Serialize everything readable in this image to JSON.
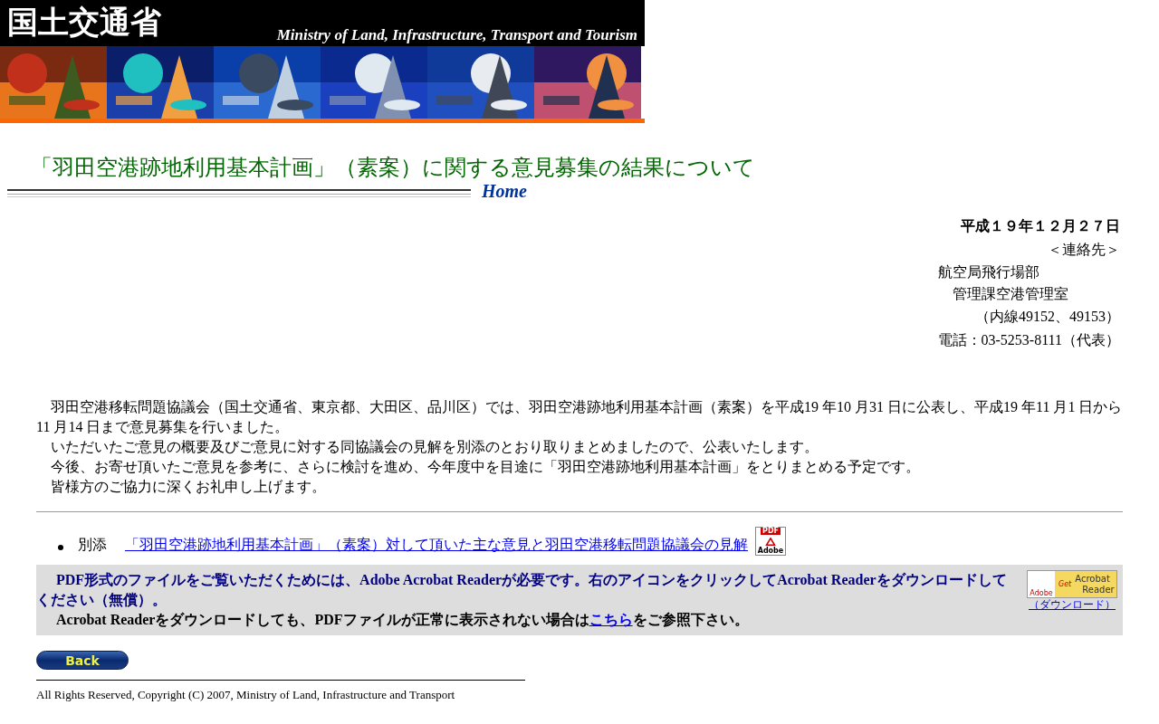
{
  "banner": {
    "title_ja": "国土交通省",
    "title_en": "Ministry of Land, Infrastructure, Transport and Tourism"
  },
  "page_title": "「羽田空港跡地利用基本計画」（素案）に関する意見募集の結果について",
  "home_link": "Home",
  "date": "平成１９年１２月２７日",
  "contact": {
    "heading": "＜連絡先＞",
    "lines": [
      "航空局飛行場部",
      "管理課空港管理室",
      "（内線49152、49153）",
      "電話：03-5253-8111（代表）"
    ]
  },
  "paragraphs": [
    "羽田空港移転問題協議会（国土交通省、東京都、大田区、品川区）では、羽田空港跡地利用基本計画（素案）を平成19 年10 月31 日に公表し、平成19 年11 月1 日から11 月14 日まで意見募集を行いました。",
    "いただいたご意見の概要及びご意見に対する同協議会の見解を別添のとおり取りまとめましたので、公表いたします。",
    "今後、お寄せ頂いたご意見を参考に、さらに検討を進め、今年度中を目途に「羽田空港跡地利用基本計画」をとりまとめる予定です。",
    "皆様方のご協力に深くお礼申し上げます。"
  ],
  "attachments": [
    {
      "label": "別添",
      "link": "「羽田空港跡地利用基本計画」（素案）対して頂いた主な意見と羽田空港移転問題協議会の見解",
      "icon_label": "PDF",
      "icon_brand": "Adobe"
    }
  ],
  "pdf_notice": {
    "line1": "PDF形式のファイルをご覧いただくためには、Adobe Acrobat Readerが必要です。右のアイコンをクリックしてAcrobat Readerをダウンロードしてください（無償）。",
    "line2_before": "Acrobat Readerをダウンロードしても、PDFファイルが正常に表示されない場合は",
    "line2_link": "こちら",
    "line2_after": "をご参照下さい。",
    "badge": {
      "brand": "Adobe",
      "get": "Get",
      "product_1": "Acrobat",
      "product_2": "Reader"
    },
    "download_link": "（ダウンロード）"
  },
  "back_button": "Back",
  "copyright": "All Rights Reserved, Copyright (C) 2007, Ministry of Land, Infrastructure and Transport"
}
